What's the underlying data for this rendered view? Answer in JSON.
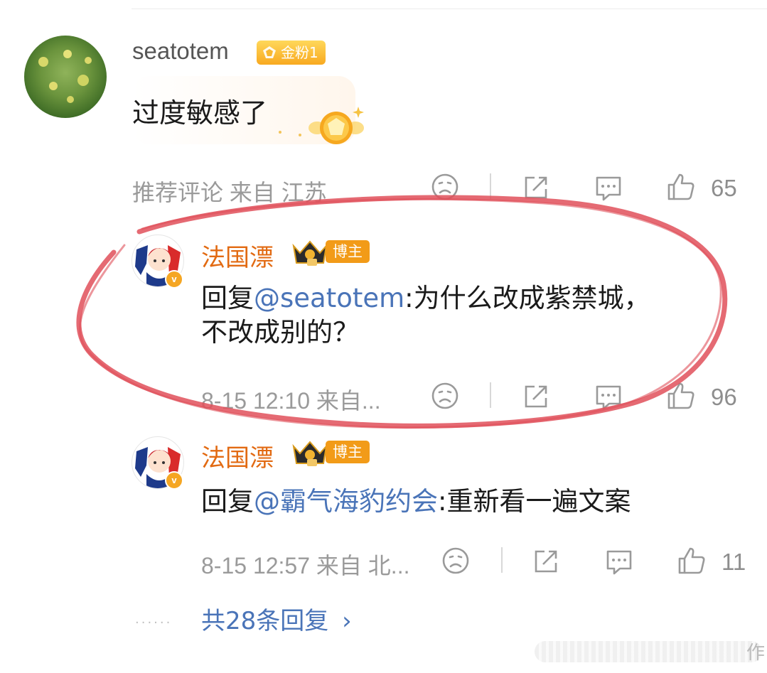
{
  "comment": {
    "username": "seatotem",
    "fan_badge": "金粉1",
    "text": "过度敏感了",
    "meta": "推荐评论  来自 江苏",
    "like_count": "65"
  },
  "replies": [
    {
      "username": "法国漂",
      "role_badge": "博主",
      "reply_prefix": "回复",
      "mention": "@seatotem",
      "text_line1": ":为什么改成紫禁城，",
      "text_line2": "不改成别的？",
      "meta": "8-15 12:10  来自...",
      "like_count": "96"
    },
    {
      "username": "法国漂",
      "role_badge": "博主",
      "reply_prefix": "回复",
      "mention": "@霸气海豹约会",
      "text_line1": ":重新看一遍文案",
      "meta": "8-15 12:57  来自 北...",
      "like_count": "11"
    }
  ],
  "more_replies_label": "共28条回复",
  "watermark_char": "作",
  "colors": {
    "mention": "#4a74b8",
    "blogger_name": "#e26a12",
    "highlight_oval": "#e0505a",
    "badge_gold": "#f8a920"
  }
}
